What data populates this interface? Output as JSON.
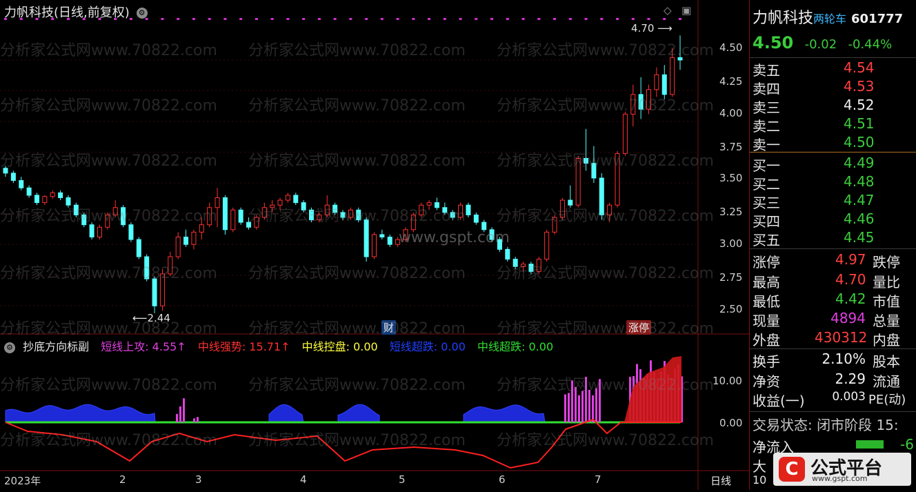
{
  "chart_header": {
    "title": "力帆科技(日线,前复权)",
    "settings_icon": "gear-icon"
  },
  "price_axis": [
    "4.50",
    "4.25",
    "4.00",
    "3.75",
    "3.50",
    "3.25",
    "3.00",
    "2.75",
    "2.50"
  ],
  "indicator_axis": [
    "10.00",
    "0.00"
  ],
  "time_axis": [
    "2023年",
    "2",
    "3",
    "4",
    "5",
    "6",
    "7"
  ],
  "period_label": "日线",
  "high_marker": "4.70",
  "low_marker": "2.44",
  "event_badges": {
    "fin": "财",
    "limit": "涨停"
  },
  "watermarks": {
    "site": "分析家公式网www.70822.com",
    "center": "www.gspt.com"
  },
  "indicator": {
    "name": "抄底方向标副",
    "items": [
      {
        "label": "短线上攻: 4.55↑",
        "color": "#e040e0"
      },
      {
        "label": "中线强势: 15.71↑",
        "color": "#ff3030"
      },
      {
        "label": "中线控盘: 0.00",
        "color": "#ffff40"
      },
      {
        "label": "短线超跌: 0.00",
        "color": "#2040ff"
      },
      {
        "label": "中线超跌: 0.00",
        "color": "#30e030"
      }
    ]
  },
  "quote": {
    "name": "力帆科技",
    "tag": "两轮车",
    "code": "601777",
    "price": "4.50",
    "change": "-0.02",
    "change_pct": "-0.44%",
    "asks": [
      {
        "label": "卖五",
        "price": "4.54",
        "color": "#ff4040"
      },
      {
        "label": "卖四",
        "price": "4.53",
        "color": "#ff4040"
      },
      {
        "label": "卖三",
        "price": "4.52",
        "color": "#f0f0f0"
      },
      {
        "label": "卖二",
        "price": "4.51",
        "color": "#3ccd3c"
      },
      {
        "label": "卖一",
        "price": "4.50",
        "color": "#3ccd3c"
      }
    ],
    "bids": [
      {
        "label": "买一",
        "price": "4.49",
        "color": "#3ccd3c"
      },
      {
        "label": "买二",
        "price": "4.48",
        "color": "#3ccd3c"
      },
      {
        "label": "买三",
        "price": "4.47",
        "color": "#3ccd3c"
      },
      {
        "label": "买四",
        "price": "4.46",
        "color": "#3ccd3c"
      },
      {
        "label": "买五",
        "price": "4.45",
        "color": "#3ccd3c"
      }
    ],
    "stats": [
      {
        "label": "涨停",
        "value": "4.97",
        "color": "#ff4040",
        "label2": "跌停"
      },
      {
        "label": "最高",
        "value": "4.70",
        "color": "#ff4040",
        "label2": "量比"
      },
      {
        "label": "最低",
        "value": "4.42",
        "color": "#3ccd3c",
        "label2": "市值"
      },
      {
        "label": "现量",
        "value": "4894",
        "color": "#e040e0",
        "label2": "总量"
      },
      {
        "label": "外盘",
        "value": "430312",
        "color": "#ff4040",
        "label2": "内盘"
      }
    ],
    "stats2": [
      {
        "label": "换手",
        "value": "2.10%",
        "label2": "股本"
      },
      {
        "label": "净资",
        "value": "2.29",
        "label2": "流通"
      },
      {
        "label": "收益(一)",
        "value": "0.003",
        "label2": "PE(动)"
      }
    ],
    "trade_status": "交易状态: 闭市阶段 15:",
    "net_inflow": "净流入",
    "net_inflow_value": "-6",
    "big": "大",
    "row10": "10"
  },
  "logo": {
    "name": "公式平台",
    "url": "www.gspt.com"
  },
  "chart_data": {
    "type": "candlestick",
    "ylim": [
      2.35,
      4.82
    ],
    "candles": [
      [
        3.62,
        3.64,
        3.55,
        3.58
      ],
      [
        3.58,
        3.6,
        3.5,
        3.52
      ],
      [
        3.52,
        3.55,
        3.44,
        3.46
      ],
      [
        3.46,
        3.48,
        3.38,
        3.4
      ],
      [
        3.4,
        3.42,
        3.32,
        3.34
      ],
      [
        3.34,
        3.4,
        3.32,
        3.39
      ],
      [
        3.39,
        3.44,
        3.37,
        3.42
      ],
      [
        3.42,
        3.44,
        3.36,
        3.38
      ],
      [
        3.38,
        3.4,
        3.3,
        3.32
      ],
      [
        3.32,
        3.34,
        3.22,
        3.24
      ],
      [
        3.24,
        3.26,
        3.14,
        3.16
      ],
      [
        3.16,
        3.18,
        3.04,
        3.06
      ],
      [
        3.06,
        3.16,
        3.04,
        3.14
      ],
      [
        3.14,
        3.26,
        3.12,
        3.24
      ],
      [
        3.24,
        3.36,
        3.22,
        3.3
      ],
      [
        3.3,
        3.32,
        3.14,
        3.16
      ],
      [
        3.16,
        3.18,
        3.02,
        3.04
      ],
      [
        3.04,
        3.06,
        2.88,
        2.9
      ],
      [
        2.9,
        2.92,
        2.7,
        2.72
      ],
      [
        2.72,
        2.74,
        2.44,
        2.5
      ],
      [
        2.5,
        2.8,
        2.46,
        2.76
      ],
      [
        2.76,
        2.94,
        2.74,
        2.9
      ],
      [
        2.9,
        3.1,
        2.88,
        3.06
      ],
      [
        3.06,
        3.12,
        2.98,
        3.0
      ],
      [
        3.0,
        3.12,
        2.96,
        3.1
      ],
      [
        3.1,
        3.22,
        3.04,
        3.16
      ],
      [
        3.16,
        3.34,
        3.14,
        3.3
      ],
      [
        3.3,
        3.46,
        3.14,
        3.38
      ],
      [
        3.38,
        3.4,
        3.08,
        3.12
      ],
      [
        3.12,
        3.3,
        3.1,
        3.28
      ],
      [
        3.28,
        3.3,
        3.16,
        3.18
      ],
      [
        3.18,
        3.22,
        3.12,
        3.14
      ],
      [
        3.14,
        3.24,
        3.12,
        3.22
      ],
      [
        3.22,
        3.34,
        3.2,
        3.3
      ],
      [
        3.3,
        3.36,
        3.26,
        3.32
      ],
      [
        3.32,
        3.38,
        3.28,
        3.36
      ],
      [
        3.36,
        3.42,
        3.34,
        3.4
      ],
      [
        3.4,
        3.42,
        3.32,
        3.34
      ],
      [
        3.34,
        3.36,
        3.26,
        3.28
      ],
      [
        3.28,
        3.3,
        3.18,
        3.2
      ],
      [
        3.2,
        3.26,
        3.18,
        3.24
      ],
      [
        3.24,
        3.4,
        3.22,
        3.32
      ],
      [
        3.32,
        3.34,
        3.24,
        3.26
      ],
      [
        3.26,
        3.28,
        3.2,
        3.22
      ],
      [
        3.22,
        3.3,
        3.2,
        3.28
      ],
      [
        3.28,
        3.3,
        3.18,
        3.2
      ],
      [
        3.2,
        3.22,
        2.86,
        2.9
      ],
      [
        2.9,
        3.1,
        2.88,
        3.08
      ],
      [
        3.08,
        3.12,
        3.04,
        3.06
      ],
      [
        3.06,
        3.08,
        2.98,
        3.0
      ],
      [
        3.0,
        3.06,
        2.98,
        3.04
      ],
      [
        3.04,
        3.14,
        3.02,
        3.12
      ],
      [
        3.12,
        3.26,
        3.1,
        3.24
      ],
      [
        3.24,
        3.34,
        3.22,
        3.32
      ],
      [
        3.32,
        3.36,
        3.28,
        3.34
      ],
      [
        3.34,
        3.38,
        3.28,
        3.3
      ],
      [
        3.3,
        3.34,
        3.24,
        3.26
      ],
      [
        3.26,
        3.28,
        3.2,
        3.22
      ],
      [
        3.22,
        3.34,
        3.2,
        3.32
      ],
      [
        3.32,
        3.34,
        3.22,
        3.24
      ],
      [
        3.24,
        3.26,
        3.16,
        3.18
      ],
      [
        3.18,
        3.2,
        3.1,
        3.12
      ],
      [
        3.12,
        3.14,
        3.02,
        3.04
      ],
      [
        3.04,
        3.06,
        2.94,
        2.96
      ],
      [
        2.96,
        2.98,
        2.86,
        2.88
      ],
      [
        2.88,
        2.9,
        2.8,
        2.82
      ],
      [
        2.82,
        2.86,
        2.78,
        2.84
      ],
      [
        2.84,
        2.86,
        2.76,
        2.78
      ],
      [
        2.78,
        2.9,
        2.76,
        2.88
      ],
      [
        2.88,
        3.12,
        2.86,
        3.1
      ],
      [
        3.1,
        3.24,
        3.08,
        3.22
      ],
      [
        3.22,
        3.38,
        3.2,
        3.36
      ],
      [
        3.36,
        3.48,
        3.3,
        3.32
      ],
      [
        3.32,
        3.72,
        3.3,
        3.7
      ],
      [
        3.7,
        3.94,
        3.6,
        3.66
      ],
      [
        3.66,
        3.8,
        3.5,
        3.54
      ],
      [
        3.54,
        3.58,
        3.2,
        3.24
      ],
      [
        3.24,
        3.34,
        3.18,
        3.32
      ],
      [
        3.32,
        3.76,
        3.3,
        3.74
      ],
      [
        3.74,
        4.08,
        3.72,
        4.06
      ],
      [
        4.06,
        4.3,
        3.96,
        4.22
      ],
      [
        4.22,
        4.36,
        4.02,
        4.1
      ],
      [
        4.1,
        4.3,
        4.06,
        4.26
      ],
      [
        4.26,
        4.44,
        4.2,
        4.38
      ],
      [
        4.38,
        4.46,
        4.18,
        4.22
      ],
      [
        4.22,
        4.6,
        4.2,
        4.52
      ],
      [
        4.52,
        4.7,
        4.42,
        4.5
      ]
    ]
  }
}
